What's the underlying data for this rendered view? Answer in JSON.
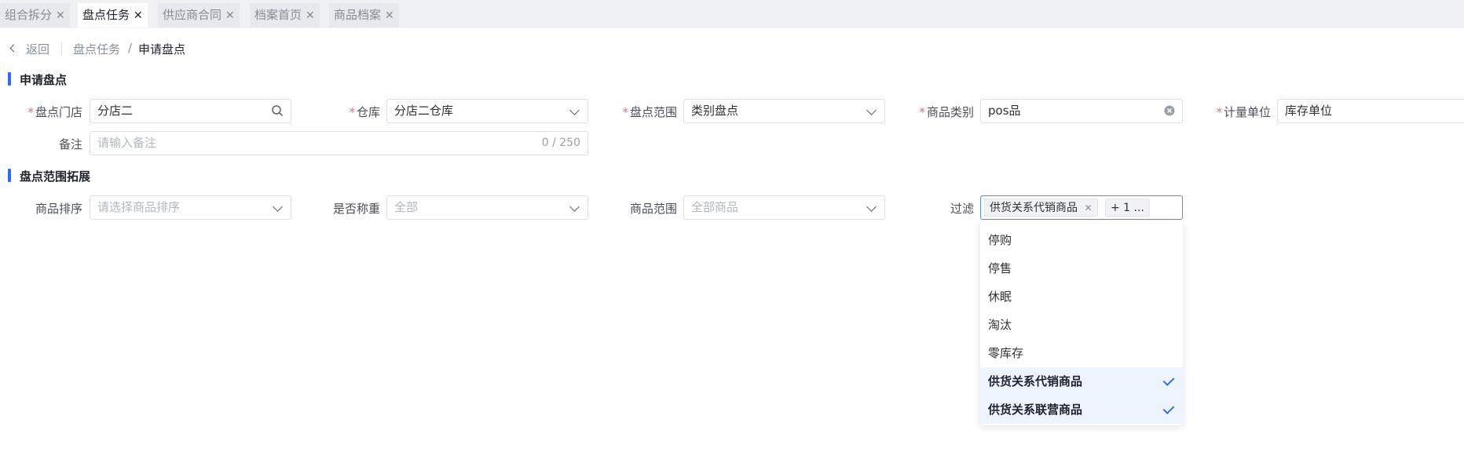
{
  "tabs": [
    {
      "label": "组合拆分",
      "active": false
    },
    {
      "label": "盘点任务",
      "active": true
    },
    {
      "label": "供应商合同",
      "active": false
    },
    {
      "label": "档案首页",
      "active": false
    },
    {
      "label": "商品档案",
      "active": false
    }
  ],
  "tab_close_glyph": "✕",
  "breadcrumb": {
    "back": "返回",
    "parent": "盘点任务",
    "separator": "/",
    "current": "申请盘点"
  },
  "section1": {
    "title": "申请盘点",
    "store": {
      "label": "盘点门店",
      "value": "分店二"
    },
    "warehouse": {
      "label": "仓库",
      "value": "分店二仓库"
    },
    "scope": {
      "label": "盘点范围",
      "value": "类别盘点"
    },
    "category": {
      "label": "商品类别",
      "value": "pos品"
    },
    "unit": {
      "label": "计量单位",
      "value": "库存单位"
    },
    "remark": {
      "label": "备注",
      "placeholder": "请输入备注",
      "counter": "0 / 250"
    }
  },
  "section2": {
    "title": "盘点范围拓展",
    "sort": {
      "label": "商品排序",
      "placeholder": "请选择商品排序"
    },
    "weighing": {
      "label": "是否称重",
      "placeholder": "全部"
    },
    "goods_range": {
      "label": "商品范围",
      "placeholder": "全部商品"
    },
    "filter": {
      "label": "过滤",
      "tag": "供货关系代销商品",
      "more_tag": "+ 1 ...",
      "options": [
        {
          "label": "停购",
          "selected": false
        },
        {
          "label": "停售",
          "selected": false
        },
        {
          "label": "休眠",
          "selected": false
        },
        {
          "label": "淘汰",
          "selected": false
        },
        {
          "label": "零库存",
          "selected": false
        },
        {
          "label": "供货关系代销商品",
          "selected": true
        },
        {
          "label": "供货关系联营商品",
          "selected": true
        }
      ]
    }
  },
  "colors": {
    "accent": "#2d6df6",
    "required": "#f56c6c",
    "selected_bg": "#eef4fe"
  }
}
